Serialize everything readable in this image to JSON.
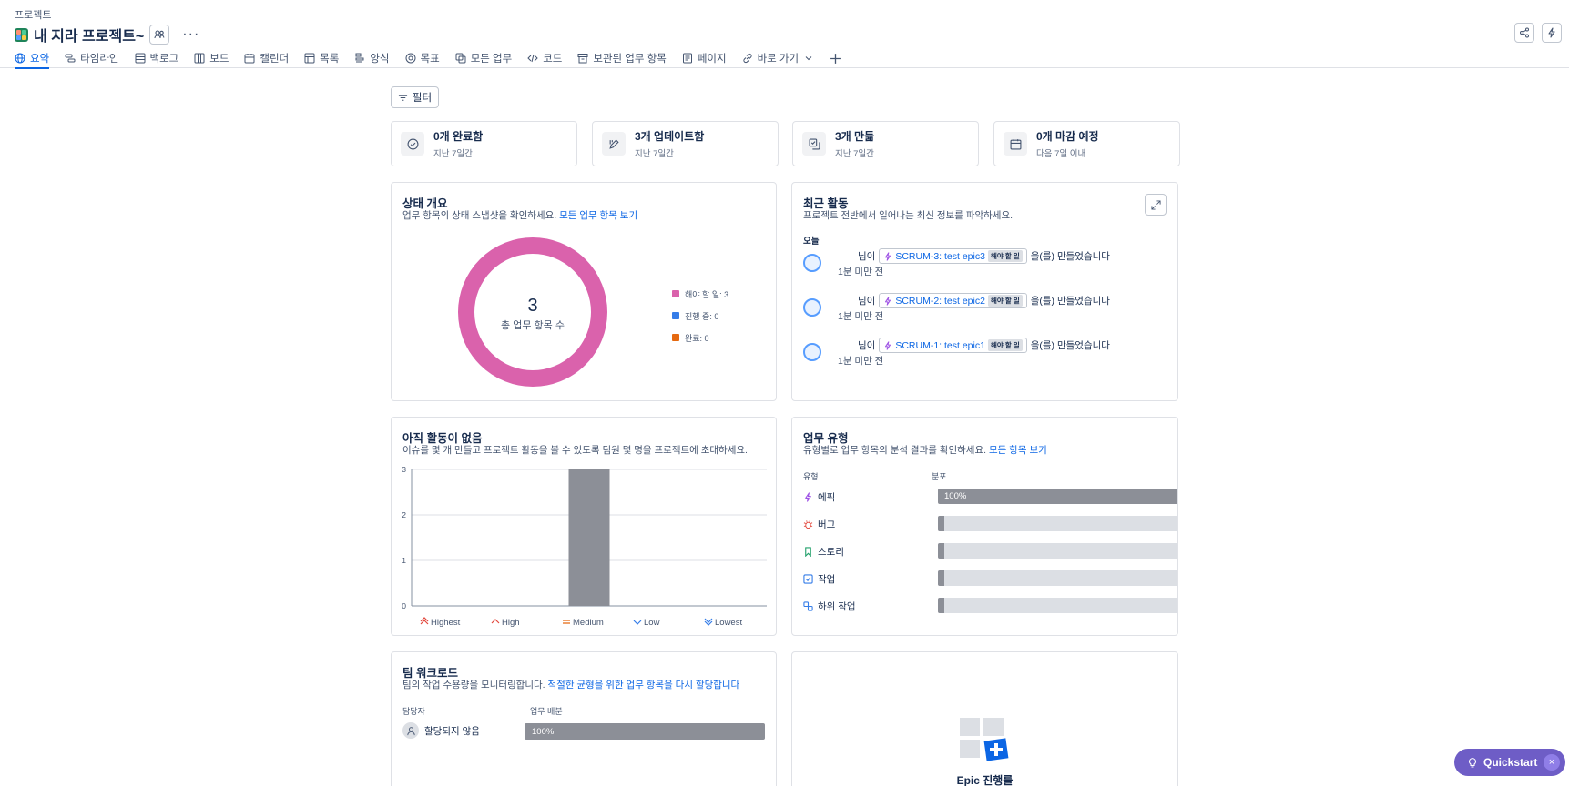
{
  "header": {
    "breadcrumb": "프로젝트",
    "title": "내 지라 프로젝트~",
    "more": "···"
  },
  "tabs": [
    {
      "label": "요약",
      "icon": "globe-icon"
    },
    {
      "label": "타임라인",
      "icon": "timeline-icon"
    },
    {
      "label": "백로그",
      "icon": "backlog-icon"
    },
    {
      "label": "보드",
      "icon": "board-icon"
    },
    {
      "label": "캘린더",
      "icon": "calendar-icon"
    },
    {
      "label": "목록",
      "icon": "list-icon"
    },
    {
      "label": "양식",
      "icon": "form-icon"
    },
    {
      "label": "목표",
      "icon": "goal-icon"
    },
    {
      "label": "모든 업무",
      "icon": "all-work-icon"
    },
    {
      "label": "코드",
      "icon": "code-icon"
    },
    {
      "label": "보관된 업무 항목",
      "icon": "archive-icon"
    },
    {
      "label": "페이지",
      "icon": "page-icon"
    },
    {
      "label": "바로 가기",
      "icon": "link-icon"
    }
  ],
  "filter": {
    "label": "필터"
  },
  "stats": [
    {
      "main": "0개 완료함",
      "sub": "지난 7일간",
      "icon": "check-circle-icon"
    },
    {
      "main": "3개 업데이트함",
      "sub": "지난 7일간",
      "icon": "edit-icon"
    },
    {
      "main": "3개 만듦",
      "sub": "지난 7일간",
      "icon": "create-icon"
    },
    {
      "main": "0개 마감 예정",
      "sub": "다음 7일 이내",
      "icon": "calendar-icon"
    }
  ],
  "status_overview": {
    "title": "상태 개요",
    "desc": "업무 항목의 상태 스냅샷을 확인하세요.",
    "link": "모든 업무 항목 보기",
    "total": "3",
    "total_label": "총 업무 항목 수",
    "legend": [
      {
        "label": "해야 할 일: 3",
        "color": "#da62ac"
      },
      {
        "label": "진행 중: 0",
        "color": "#357de8"
      },
      {
        "label": "완료: 0",
        "color": "#e56910"
      }
    ]
  },
  "recent_activity": {
    "title": "최근 활동",
    "desc": "프로젝트 전반에서 일어나는 최신 정보를 파악하세요.",
    "today": "오늘",
    "items": [
      {
        "prefix": "님이",
        "key": "SCRUM-3: test epic3",
        "status": "해야 할 일",
        "suffix": "을(를) 만들었습니다",
        "time": "1분 미만 전"
      },
      {
        "prefix": "님이",
        "key": "SCRUM-2: test epic2",
        "status": "해야 할 일",
        "suffix": "을(를) 만들었습니다",
        "time": "1분 미만 전"
      },
      {
        "prefix": "님이",
        "key": "SCRUM-1: test epic1",
        "status": "해야 할 일",
        "suffix": "을(를) 만들었습니다",
        "time": "1분 미만 전"
      }
    ]
  },
  "priority": {
    "title": "아직 활동이 없음",
    "desc": "이슈를 몇 개 만들고 프로젝트 활동을 볼 수 있도록 팀원 몇 명을 프로젝트에 초대하세요."
  },
  "chart_data": {
    "type": "bar",
    "categories": [
      "Highest",
      "High",
      "Medium",
      "Low",
      "Lowest"
    ],
    "values": [
      0,
      0,
      3,
      0,
      0
    ],
    "ylim": [
      0,
      3
    ],
    "yticks": [
      "0",
      "1",
      "2",
      "3"
    ],
    "bar_color": "#8c8f97",
    "category_colors": [
      "#e2483d",
      "#e2483d",
      "#e56910",
      "#357de8",
      "#357de8"
    ]
  },
  "work_types": {
    "title": "업무 유형",
    "desc": "유형별로 업무 항목의 분석 결과를 확인하세요.",
    "link": "모든 항목 보기",
    "col_type": "유형",
    "col_dist": "분포",
    "rows": [
      {
        "label": "에픽",
        "icon": "epic-icon",
        "color": "#9f54e5",
        "percent": 100,
        "text": "100%"
      },
      {
        "label": "버그",
        "icon": "bug-icon",
        "color": "#e2483d",
        "percent": 0,
        "text": ""
      },
      {
        "label": "스토리",
        "icon": "story-icon",
        "color": "#22a06b",
        "percent": 0,
        "text": ""
      },
      {
        "label": "작업",
        "icon": "task-icon",
        "color": "#357de8",
        "percent": 0,
        "text": ""
      },
      {
        "label": "하위 작업",
        "icon": "subtask-icon",
        "color": "#357de8",
        "percent": 0,
        "text": ""
      }
    ]
  },
  "workload": {
    "title": "팀 워크로드",
    "desc": "팀의 작업 수용량을 모니터링합니다.",
    "link": "적절한 균형을 위한 업무 항목을 다시 할당합니다",
    "col_assignee": "담당자",
    "col_dist": "업무 배분",
    "rows": [
      {
        "label": "할당되지 않음",
        "percent": 100,
        "text": "100%"
      }
    ]
  },
  "epic": {
    "title": "Epic 진행률"
  },
  "quickstart": {
    "label": "Quickstart",
    "close": "×"
  }
}
